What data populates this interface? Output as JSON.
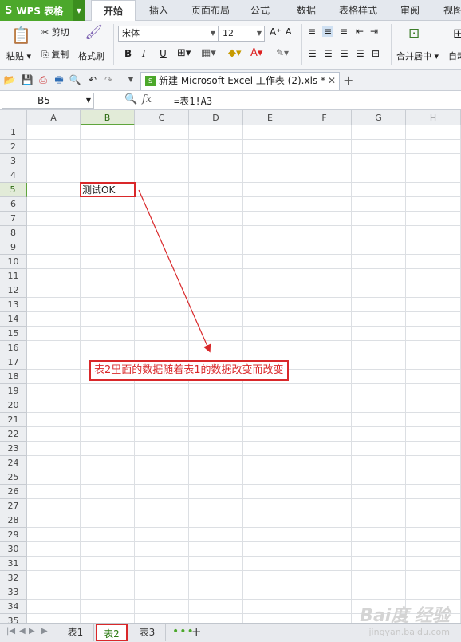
{
  "app": {
    "name": "WPS 表格"
  },
  "ribbon_tabs": [
    "开始",
    "插入",
    "页面布局",
    "公式",
    "数据",
    "表格样式",
    "审阅",
    "视图"
  ],
  "active_tab": "开始",
  "ribbon": {
    "cut": "剪切",
    "copy": "复制",
    "paste": "粘贴",
    "format_painter": "格式刷",
    "font_name": "宋体",
    "font_size": "12",
    "bold": "B",
    "italic": "I",
    "underline": "U",
    "merge_center": "合并居中",
    "auto_wrap": "自动"
  },
  "document": {
    "tab_title": "新建 Microsoft Excel 工作表 (2).xls *"
  },
  "formula_bar": {
    "name_box": "B5",
    "fx": "fx",
    "formula": "=表1!A3"
  },
  "columns": [
    "A",
    "B",
    "C",
    "D",
    "E",
    "F",
    "G",
    "H"
  ],
  "rows": [
    "1",
    "2",
    "3",
    "4",
    "5",
    "6",
    "7",
    "8",
    "9",
    "10",
    "11",
    "12",
    "13",
    "14",
    "15",
    "16",
    "17",
    "18",
    "19",
    "20",
    "21",
    "22",
    "23",
    "24",
    "25",
    "26",
    "27",
    "28",
    "29",
    "30",
    "31",
    "32",
    "33",
    "34",
    "35"
  ],
  "selected_cell": {
    "ref": "B5",
    "value": "测试OK"
  },
  "annotation": {
    "text": "表2里面的数据随着表1的数据改变而改变"
  },
  "sheets": [
    "表1",
    "表2",
    "表3"
  ],
  "active_sheet": "表2",
  "watermark": {
    "brand": "Bai度 经验",
    "url": "jingyan.baidu.com"
  },
  "colors": {
    "accent": "#4ca82b",
    "annotation_red": "#d9282a",
    "selection_green": "#5fa53c"
  }
}
